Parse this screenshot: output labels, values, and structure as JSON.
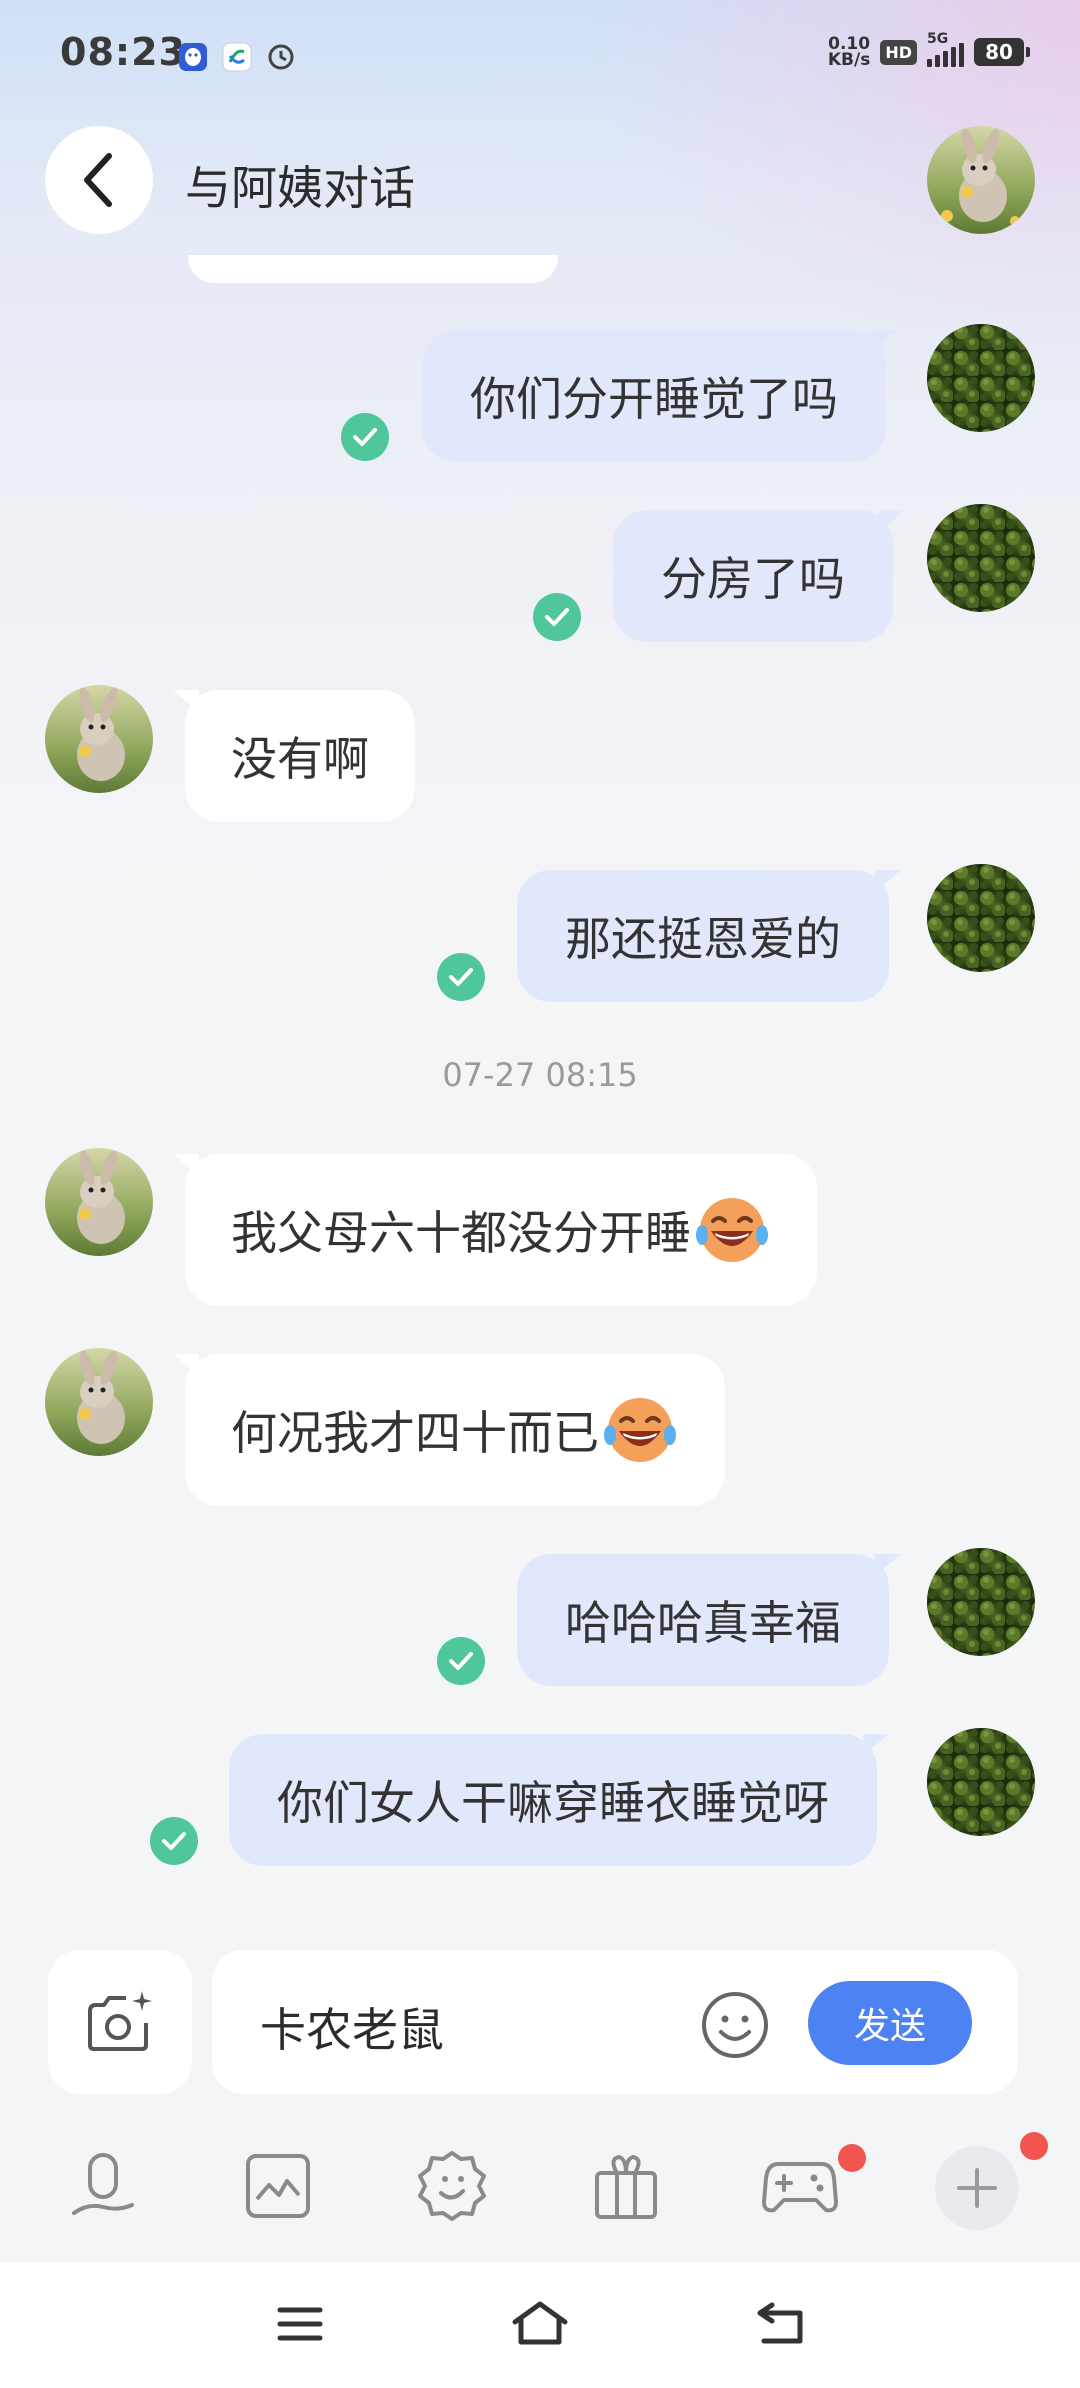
{
  "status_bar": {
    "time": "08:23",
    "net_speed_value": "0.10",
    "net_speed_unit": "KB/s",
    "hd_badge": "HD",
    "network_type": "5G",
    "battery": "80",
    "app_icons": [
      "qq-icon",
      "mobile-service-icon",
      "sync-icon"
    ]
  },
  "header": {
    "title": "与阿姨对话",
    "back_icon": "chevron-left-icon",
    "contact_avatar": "rabbit-avatar"
  },
  "messages": [
    {
      "sender": "me",
      "text": "你们分开睡觉了吗",
      "read": true
    },
    {
      "sender": "me",
      "text": "分房了吗",
      "read": true
    },
    {
      "sender": "contact",
      "text": "没有啊"
    },
    {
      "sender": "me",
      "text": "那还挺恩爱的",
      "read": true
    },
    {
      "sender": "contact",
      "text": "我父母六十都没分开睡",
      "emoji": "laugh-cry-emoji"
    },
    {
      "sender": "contact",
      "text": "何况我才四十而已",
      "emoji": "laugh-cry-emoji"
    },
    {
      "sender": "me",
      "text": "哈哈哈真幸福",
      "read": true
    },
    {
      "sender": "me",
      "text": "你们女人干嘛穿睡衣睡觉呀",
      "read": true
    }
  ],
  "timestamp": "07-27 08:15",
  "composer": {
    "input_value": "卡农老鼠",
    "send_label": "发送",
    "camera_icon": "camera-sparkle-icon",
    "emoji_icon": "smiley-icon"
  },
  "toolbar": {
    "items": [
      {
        "icon": "voice-icon",
        "badge": false
      },
      {
        "icon": "image-icon",
        "badge": false
      },
      {
        "icon": "sticker-icon",
        "badge": false
      },
      {
        "icon": "gift-icon",
        "badge": false
      },
      {
        "icon": "game-icon",
        "badge": true
      },
      {
        "icon": "plus-icon",
        "badge": true
      }
    ]
  },
  "nav_bar": {
    "items": [
      "menu-icon",
      "home-icon",
      "back-icon"
    ]
  },
  "colors": {
    "outgoing_bubble": "#e2e8fb",
    "incoming_bubble": "#ffffff",
    "read_check": "#4fc79a",
    "send_button": "#4d82f3",
    "badge_red": "#f2554f"
  }
}
